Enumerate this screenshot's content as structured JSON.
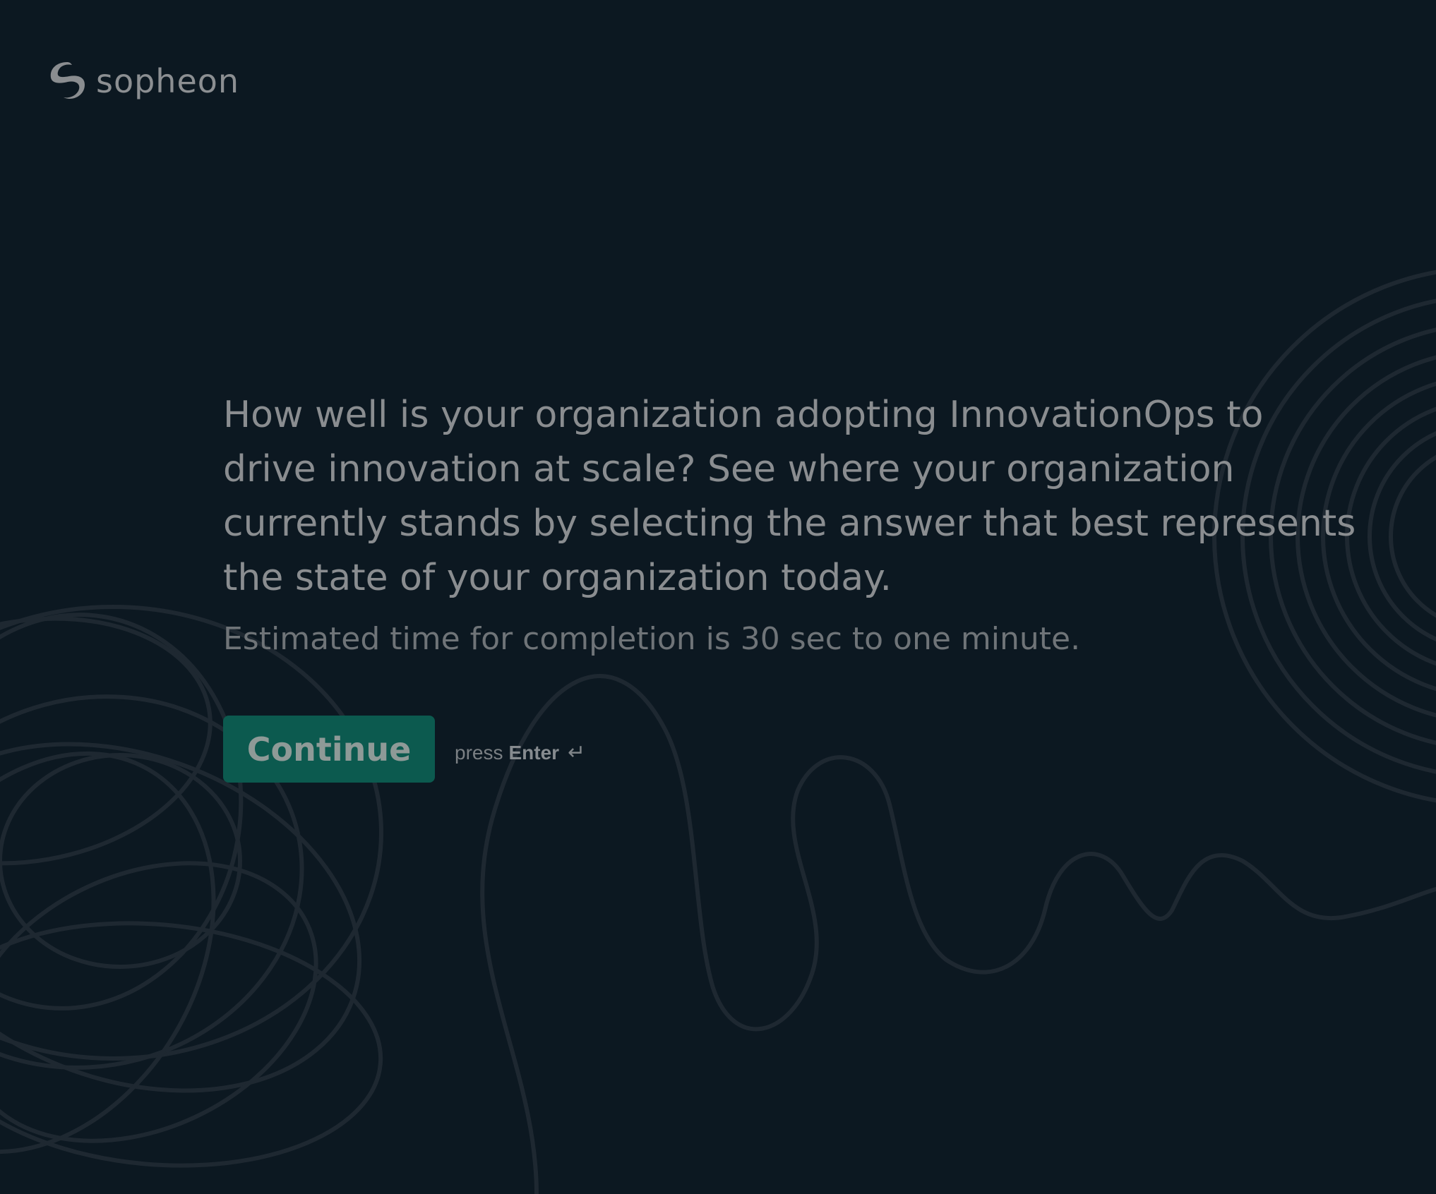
{
  "brand": {
    "name": "sopheon",
    "logo_icon": "sopheon-swirl-logo"
  },
  "intro": {
    "question": "How well is your organization adopting InnovationOps to drive innovation at scale? See where your organization currently stands by selecting the answer that best represents the state of your organization today.",
    "estimate": "Estimated time for completion is 30 sec to one minute."
  },
  "cta": {
    "continue_label": "Continue",
    "hint_prefix": "press",
    "hint_key": "Enter",
    "hint_icon": "↵"
  },
  "colors": {
    "background": "#0c1821",
    "accent": "#0c5a4f",
    "decorative_lines": "#1f2a33"
  }
}
